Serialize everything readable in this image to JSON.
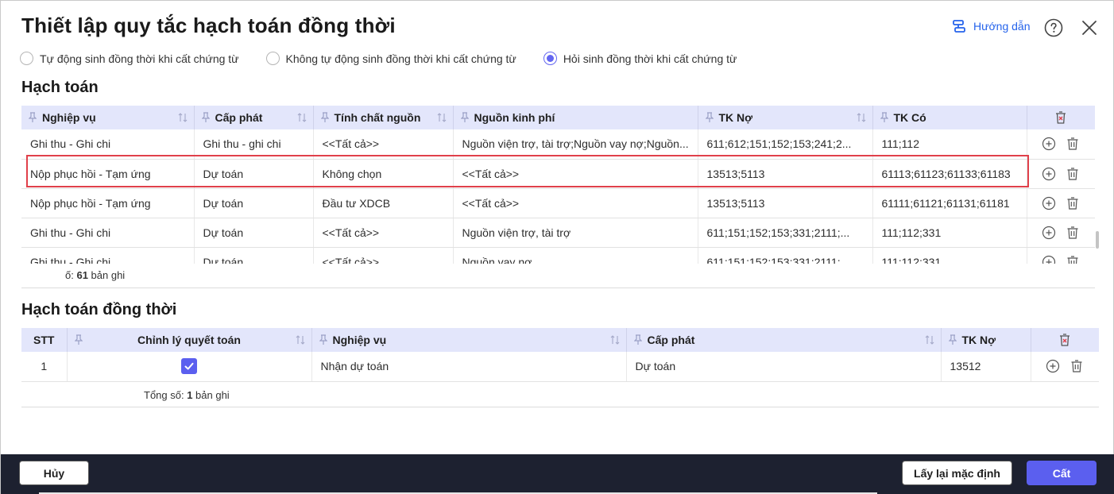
{
  "dialog": {
    "title": "Thiết lập quy tắc hạch toán đồng thời",
    "guide_label": "Hướng dẫn"
  },
  "options": [
    {
      "label": "Tự động sinh đồng thời khi cất chứng từ",
      "checked": false
    },
    {
      "label": "Không tự động sinh đồng thời khi cất chứng từ",
      "checked": false
    },
    {
      "label": "Hỏi sinh đồng thời khi cất chứng từ",
      "checked": true
    }
  ],
  "hach_toan": {
    "section_title": "Hạch toán",
    "columns": [
      "Nghiệp vụ",
      "Cấp phát",
      "Tính chất nguồn",
      "Nguồn kinh phí",
      "TK Nợ",
      "TK Có"
    ],
    "rows": [
      [
        "Ghi thu - Ghi chi",
        "Ghi thu - ghi chi",
        "<<Tất cả>>",
        "Nguồn viện trợ, tài trợ;Nguồn vay nợ;Nguồn...",
        "611;612;151;152;153;241;2...",
        "111;112"
      ],
      [
        "Nộp phục hồi - Tạm ứng",
        "Dự toán",
        "Không chọn",
        "<<Tất cả>>",
        "13513;5113",
        "61113;61123;61133;61183"
      ],
      [
        "Nộp phục hồi - Tạm ứng",
        "Dự toán",
        "Đầu tư XDCB",
        "<<Tất cả>>",
        "13513;5113",
        "61111;61121;61131;61181"
      ],
      [
        "Ghi thu - Ghi chi",
        "Dự toán",
        "<<Tất cả>>",
        "Nguồn viện trợ, tài trợ",
        "611;151;152;153;331;2111;...",
        "111;112;331"
      ],
      [
        "Ghi thu - Ghi chi",
        "Dự toán",
        "<<Tất cả>>",
        "Nguồn vay nợ",
        "611;151;152;153;331;2111;...",
        "111;112;331"
      ]
    ],
    "summary_prefix": "ố: ",
    "summary_count": "61",
    "summary_suffix": " bản ghi"
  },
  "dong_thoi": {
    "section_title": "Hạch toán đồng thời",
    "columns": [
      "STT",
      "Chỉnh lý quyết toán",
      "Nghiệp vụ",
      "Cấp phát",
      "TK Nợ"
    ],
    "rows": [
      {
        "stt": "1",
        "chinh_ly": true,
        "nghiep_vu": "Nhận dự toán",
        "cap_phat": "Dự toán",
        "tk_no": "13512"
      }
    ],
    "summary_prefix": "Tổng số: ",
    "summary_count": "1",
    "summary_suffix": " bản ghi"
  },
  "footer": {
    "cancel_label": "Hủy",
    "reset_label": "Lấy lại mặc định",
    "save_label": "Cất"
  },
  "colors": {
    "accent": "#5b5fef",
    "header_bg": "#e3e6fb",
    "highlight": "#e0404a",
    "footer_bg": "#1d2130",
    "link": "#2563eb"
  }
}
